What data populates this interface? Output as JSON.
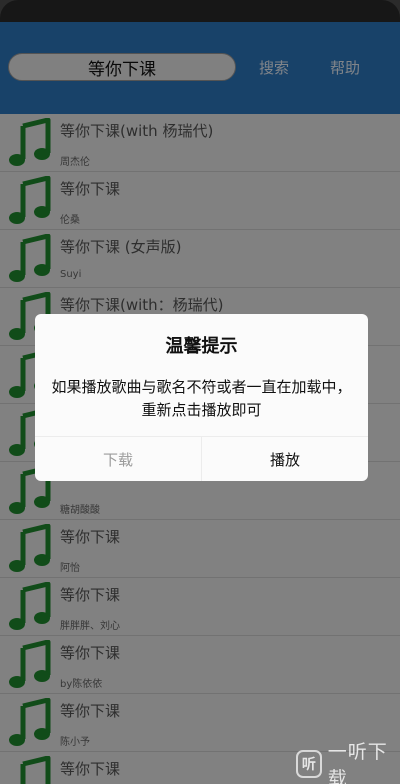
{
  "header": {
    "search_query": "等你下课",
    "search_label": "搜索",
    "help_label": "帮助",
    "background_color": "#2d78c0"
  },
  "icon": {
    "name": "music-note-icon",
    "color": "#1f8a2e"
  },
  "songs": [
    {
      "title": "等你下课(with 杨瑞代)",
      "artist": "周杰伦"
    },
    {
      "title": "等你下课",
      "artist": "伦桑"
    },
    {
      "title": "等你下课 (女声版)",
      "artist": "Suyi"
    },
    {
      "title": "等你下课(with：杨瑞代)",
      "artist": ""
    },
    {
      "title": "",
      "artist": ""
    },
    {
      "title": "",
      "artist": ""
    },
    {
      "title": "",
      "artist": "糖胡酸酸"
    },
    {
      "title": "等你下课",
      "artist": "阿怡"
    },
    {
      "title": "等你下课",
      "artist": "胖胖胖、刘心"
    },
    {
      "title": "等你下课",
      "artist": "by陈依依"
    },
    {
      "title": "等你下课",
      "artist": "陈小予"
    },
    {
      "title": "等你下课",
      "artist": ""
    }
  ],
  "dialog": {
    "title": "温馨提示",
    "message": "如果播放歌曲与歌名不符或者一直在加载中，重新点击播放即可",
    "download_label": "下载",
    "play_label": "播放"
  },
  "watermark": {
    "logo_text": "听",
    "text": "一听下载"
  }
}
